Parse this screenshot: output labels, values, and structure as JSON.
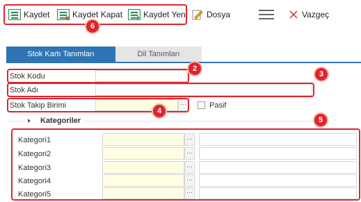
{
  "toolbar": {
    "save_label": "Kaydet",
    "save_close_label": "Kaydet Kapat",
    "save_new_label": "Kaydet Yeni",
    "file_label": "Dosya",
    "cancel_label": "Vazgeç"
  },
  "tabs": {
    "stock_card": "Stok Kartı Tanımları",
    "language": "Dil Tanımları"
  },
  "form": {
    "stock_code_label": "Stok Kodu",
    "stock_code_value": "",
    "stock_name_label": "Stok Adı",
    "stock_name_value": "",
    "tracking_unit_label": "Stok Takip Birimi",
    "tracking_unit_value": "",
    "passive_label": "Pasif",
    "lookup_glyph": "···"
  },
  "categories": {
    "title": "Kategoriler",
    "items": [
      {
        "label": "Kategori1",
        "code": "",
        "name": ""
      },
      {
        "label": "Kategori2",
        "code": "",
        "name": ""
      },
      {
        "label": "Kategori3",
        "code": "",
        "name": ""
      },
      {
        "label": "Kategori4",
        "code": "",
        "name": ""
      },
      {
        "label": "Kategori5",
        "code": "",
        "name": ""
      }
    ]
  },
  "badges": [
    "2",
    "3",
    "4",
    "5",
    "6"
  ],
  "colors": {
    "accent": "#2f75b5",
    "highlight": "#e0242c",
    "required_field": "#fffde2"
  }
}
